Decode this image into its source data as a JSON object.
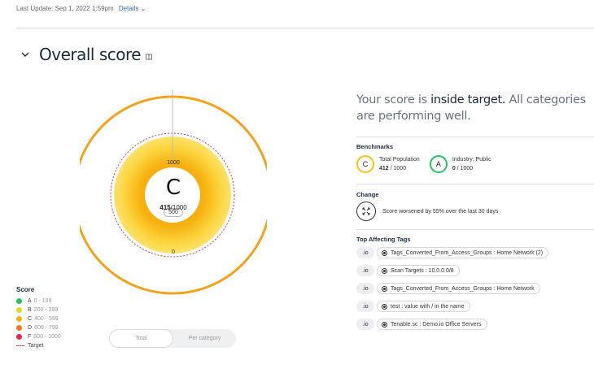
{
  "header": {
    "last_update": "Last Update: Sep 1, 2022 1:59pm",
    "details_label": "Details"
  },
  "section": {
    "title": "Overall score"
  },
  "gauge": {
    "tick_max": "1000",
    "tick_mid": "500",
    "tick_min": "0",
    "grade": "C",
    "score_value": "415",
    "score_total": "/1000"
  },
  "legend": {
    "title": "Score",
    "items": [
      {
        "grade": "A",
        "range": "0 - 199",
        "color": "#22c55e"
      },
      {
        "grade": "B",
        "range": "200 - 399",
        "color": "#e4d82a"
      },
      {
        "grade": "C",
        "range": "400 - 599",
        "color": "#f6b20b"
      },
      {
        "grade": "D",
        "range": "600 - 799",
        "color": "#f07a1a"
      },
      {
        "grade": "F",
        "range": "800 - 1000",
        "color": "#e8294c"
      }
    ],
    "target_label": "Target"
  },
  "view_toggle": {
    "options": [
      "Total",
      "Per category"
    ],
    "active": "Total"
  },
  "summary": {
    "prefix": "Your score is ",
    "status": "inside target.",
    "suffix": " All categories are performing well."
  },
  "benchmarks": {
    "title": "Benchmarks",
    "items": [
      {
        "grade": "C",
        "label": "Total Population",
        "value": "412",
        "total": " / 1000",
        "color": "#f6c21b"
      },
      {
        "grade": "A",
        "label": "Industry: Public",
        "value": "0",
        "total": " / 1000",
        "color": "#22c55e"
      }
    ]
  },
  "change": {
    "title": "Change",
    "text": "Score worsened by 55% over the last 30 days"
  },
  "tags": {
    "title": "Top Affecting Tags",
    "items": [
      {
        "badge": ".io",
        "label": "Tags_Converted_From_Access_Groups : Home Network (2)"
      },
      {
        "badge": ".io",
        "label": "Scan Targets : 10.0.0.0/8"
      },
      {
        "badge": ".io",
        "label": "Tags_Converted_From_Access_Groups : Home Network"
      },
      {
        "badge": ".io",
        "label": "test : value with / in the name"
      },
      {
        "badge": ".io",
        "label": "Tenable.sc : Demo.io Office Servers"
      }
    ]
  }
}
